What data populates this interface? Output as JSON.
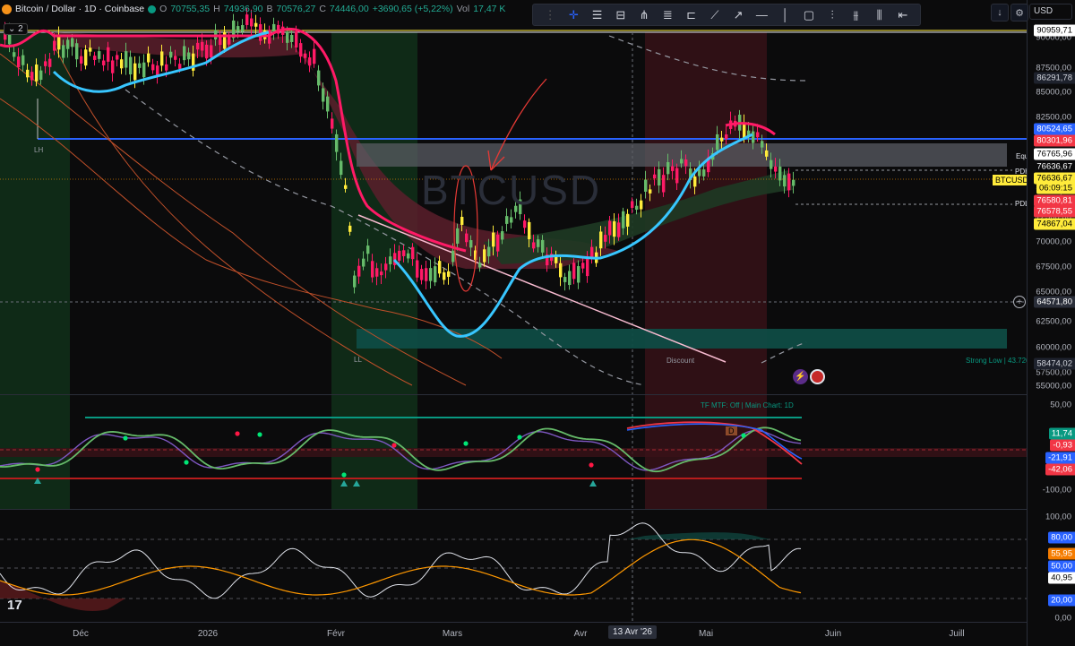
{
  "symbol": {
    "title": "Bitcoin / Dollar · 1D · Coinbase",
    "open_key": "O",
    "open": "70755,35",
    "high_key": "H",
    "high": "74936,90",
    "low_key": "B",
    "low": "70576,27",
    "close_key": "C",
    "close": "74446,00",
    "change": "+3690,65 (+5,22%)",
    "volume_key": "Vol",
    "volume": "17,47 K",
    "indicator_count": "2",
    "watermark": "BTCUSD"
  },
  "toolbar": {
    "currency": "USD",
    "tools": [
      "crosshair-icon",
      "horizontal-lines-icon",
      "horizontal-ray-icon",
      "pitchfork-icon",
      "channel-icon",
      "brackets-icon",
      "path-icon",
      "arrow-line-icon",
      "horizontal-line-icon",
      "vertical-line-icon",
      "rectangle-icon",
      "long-position-icon",
      "short-position-icon",
      "candles-icon",
      "ruler-icon"
    ]
  },
  "price_scale": {
    "ticks": [
      "90000,00",
      "87500,00",
      "85000,00",
      "82500,00",
      "80000,00",
      "77500,00",
      "75000,00",
      "72500,00",
      "70000,00",
      "67500,00",
      "65000,00",
      "62500,00",
      "60000,00",
      "57500,00",
      "55000,00"
    ],
    "labels": [
      {
        "text": "90959,71",
        "bg": "#ffffff",
        "fg": "#000000"
      },
      {
        "text": "86291,78",
        "bg": "#1e222d",
        "fg": "#d1d4dc"
      },
      {
        "text": "80524,65",
        "bg": "#2962ff",
        "fg": "#ffffff"
      },
      {
        "text": "80301,96",
        "bg": "#f23645",
        "fg": "#ffffff"
      },
      {
        "text": "76765,96",
        "bg": "#ffffff",
        "fg": "#000000"
      },
      {
        "text": "76636,67",
        "bg": "#0b0b0c",
        "fg": "#ffffff"
      },
      {
        "text": "76636,67",
        "bg": "#ffeb3b",
        "fg": "#000000"
      },
      {
        "text": "06:09:15",
        "bg": "#ffeb3b",
        "fg": "#000000"
      },
      {
        "text": "76580,81",
        "bg": "#f23645",
        "fg": "#ffffff"
      },
      {
        "text": "76578,55",
        "bg": "#f23645",
        "fg": "#ffffff"
      },
      {
        "text": "74867,04",
        "bg": "#ffeb3b",
        "fg": "#000000"
      },
      {
        "text": "64571,80",
        "bg": "#2a2e39",
        "fg": "#ffffff"
      },
      {
        "text": "58474,02",
        "bg": "#1e222d",
        "fg": "#d1d4dc"
      }
    ],
    "osc_ticks": [
      "50,00",
      "0,00",
      "-50,00",
      "-100,00"
    ],
    "osc_labels": [
      {
        "text": "11,74",
        "bg": "#089981",
        "fg": "#ffffff"
      },
      {
        "text": "-0,93",
        "bg": "#f23645",
        "fg": "#ffffff"
      },
      {
        "text": "-21,91",
        "bg": "#2962ff",
        "fg": "#ffffff"
      },
      {
        "text": "-42,06",
        "bg": "#f23645",
        "fg": "#ffffff"
      }
    ],
    "rsi_ticks": [
      "100,00",
      "0,00"
    ],
    "rsi_labels": [
      {
        "text": "80,00",
        "bg": "#2962ff",
        "fg": "#ffffff"
      },
      {
        "text": "55,95",
        "bg": "#f57c00",
        "fg": "#ffffff"
      },
      {
        "text": "50,00",
        "bg": "#2962ff",
        "fg": "#ffffff"
      },
      {
        "text": "40,95",
        "bg": "#ffffff",
        "fg": "#000000"
      },
      {
        "text": "20,00",
        "bg": "#2962ff",
        "fg": "#ffffff"
      }
    ]
  },
  "annotations": {
    "lh": "LH",
    "ll": "LL",
    "discount": "Discount",
    "strong_low": "Strong Low | 43.726",
    "equ": "Equ",
    "pdh": "PDH",
    "pdl": "PDL",
    "btcusd_tag": "BTCUSD",
    "tf_info": "TF MTF: Off  |  Main Chart: 1D",
    "div_marker": "D"
  },
  "time_axis": {
    "ticks": [
      "Déc",
      "2026",
      "Févr",
      "Mars",
      "Avr",
      "Mai",
      "Juin",
      "Juill"
    ],
    "crosshair": "13 Avr '26"
  }
}
